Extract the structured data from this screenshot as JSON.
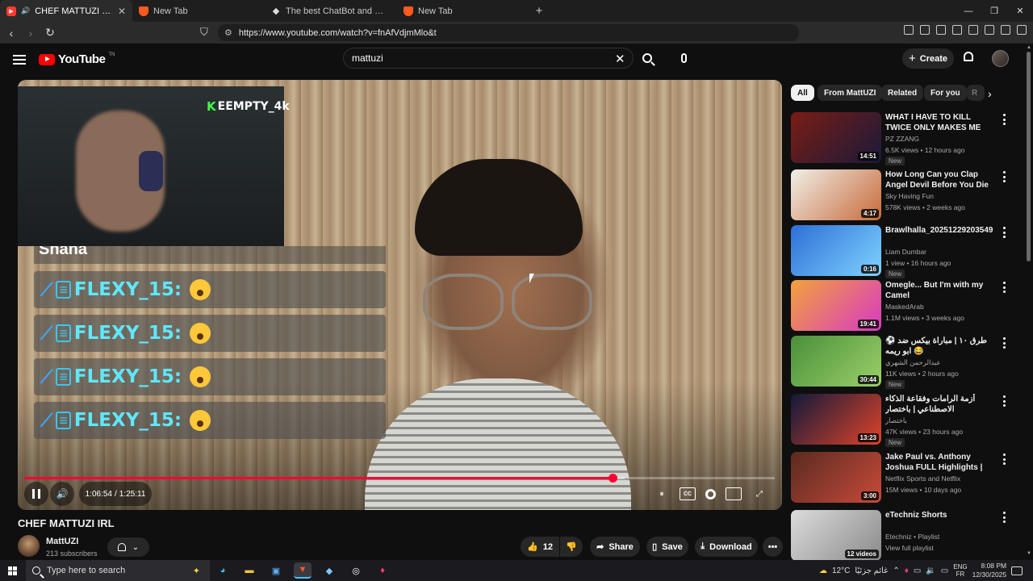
{
  "browser": {
    "tabs": [
      {
        "label": "CHEF MATTUZI IRL - YouTube",
        "active": true
      },
      {
        "label": "New Tab",
        "active": false
      },
      {
        "label": "The best ChatBot and Widgets for Ki",
        "active": false
      },
      {
        "label": "New Tab",
        "active": false
      }
    ],
    "url": "https://www.youtube.com/watch?v=fnAfVdjmMlo&t"
  },
  "header": {
    "logo_text": "YouTube",
    "logo_tm": "TN",
    "search_value": "mattuzi",
    "create_label": "Create"
  },
  "player": {
    "webcam_name": "EEMPTY_4k",
    "chat_partial": "Shana",
    "chat_rows": [
      {
        "user": "FLEXY_15:"
      },
      {
        "user": "FLEXY_15:"
      },
      {
        "user": "FLEXY_15:"
      },
      {
        "user": "FLEXY_15:"
      }
    ],
    "time_current": "1:06:54",
    "time_separator": "/",
    "time_total": "1:25:11",
    "progress_played_fraction": 0.784,
    "progress_buffered_fraction": 0.8,
    "controls": {
      "cc_label": "CC"
    }
  },
  "video": {
    "title": "CHEF MATTUZI IRL",
    "channel": "MattUZI",
    "subscribers": "213 subscribers",
    "likes": "12",
    "share_label": "Share",
    "save_label": "Save",
    "download_label": "Download"
  },
  "chips": [
    "All",
    "From MattUZI",
    "Related",
    "For you",
    "R"
  ],
  "recommendations": [
    {
      "title": "WHAT I HAVE TO KILL TWICE ONLY MAKES ME STRONGER",
      "channel": "PZ ZZANG",
      "meta": "6.5K views • 12 hours ago",
      "badge": "New",
      "duration": "14:51",
      "color_a": "#7a1c14",
      "color_b": "#1a1a3a"
    },
    {
      "title": "How Long Can you Clap Angel Devil Before You Die ??",
      "channel": "Sky Having Fun",
      "meta": "578K views • 2 weeks ago",
      "badge": "",
      "duration": "4:17",
      "color_a": "#f1efe8",
      "color_b": "#c76a3a"
    },
    {
      "title": "Brawlhalla_20251229203549",
      "channel": "Liam Dumbar",
      "meta": "1 view • 16 hours ago",
      "badge": "New",
      "duration": "0:16",
      "color_a": "#2e6fd6",
      "color_b": "#7fd3ff"
    },
    {
      "title": "Omegle... But I'm with my Camel",
      "channel": "MaskedArab",
      "meta": "1.1M views • 3 weeks ago",
      "badge": "",
      "duration": "19:41",
      "color_a": "#f2a23a",
      "color_b": "#d83ac3"
    },
    {
      "title": "⚽ طرق ١٠ | مباراة بيكس ضد ابو ريمه 😂",
      "channel": "عبدالرحمن الشهري",
      "meta": "11K views • 2 hours ago",
      "badge": "New",
      "duration": "30:44",
      "color_a": "#4a8f3a",
      "color_b": "#9bd06a"
    },
    {
      "title": "أزمة الرامات وفقاعة الذكاء الاصطناعي | باختصار",
      "channel": "باختصار",
      "meta": "47K views • 23 hours ago",
      "badge": "New",
      "duration": "13:23",
      "color_a": "#101a3a",
      "color_b": "#e0432a"
    },
    {
      "title": "Jake Paul vs. Anthony Joshua FULL Highlights | Netflix",
      "channel": "Netflix Sports and Netflix",
      "meta": "15M views • 10 days ago",
      "badge": "",
      "duration": "3:00",
      "color_a": "#5a2a20",
      "color_b": "#c84a3a"
    },
    {
      "title": "eTechniz Shorts",
      "channel": "Etechniz • Playlist",
      "meta": "View full playlist",
      "badge": "",
      "duration": "12 videos",
      "color_a": "#dcdcdc",
      "color_b": "#8a8a8a"
    }
  ],
  "taskbar": {
    "search_placeholder": "Type here to search",
    "weather": "12°C",
    "weather_text": "غائم جزئيًا",
    "lang_top": "ENG",
    "lang_bottom": "FR",
    "time": "8:08 PM",
    "date": "12/30/2025"
  }
}
